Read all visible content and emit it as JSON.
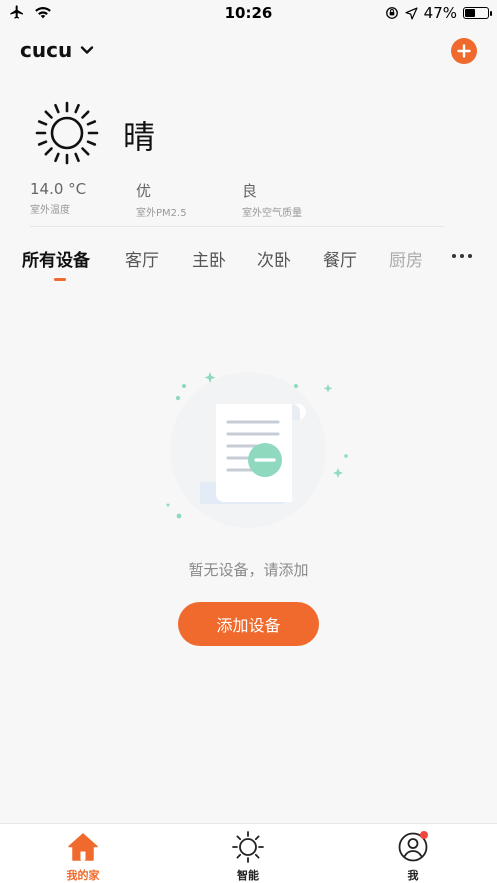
{
  "status_bar": {
    "time": "10:26",
    "battery_text": "47%",
    "battery_level": 0.47
  },
  "header": {
    "home_name": "cucu"
  },
  "weather": {
    "condition": "晴",
    "icon": "sun-icon",
    "metrics": [
      {
        "value": "14.0 °C",
        "label": "室外温度"
      },
      {
        "value": "优",
        "label": "室外PM2.5"
      },
      {
        "value": "良",
        "label": "室外空气质量"
      }
    ]
  },
  "rooms": {
    "tabs": [
      "所有设备",
      "客厅",
      "主卧",
      "次卧",
      "餐厅",
      "厨房"
    ],
    "active_index": 0
  },
  "empty_state": {
    "message": "暂无设备，请添加",
    "button_label": "添加设备"
  },
  "tabbar": {
    "items": [
      {
        "label": "我的家",
        "icon": "home-icon"
      },
      {
        "label": "智能",
        "icon": "smart-sun-icon"
      },
      {
        "label": "我",
        "icon": "profile-icon"
      }
    ],
    "active_index": 0
  },
  "colors": {
    "accent": "#ef6a2c",
    "badge": "#f0463c",
    "illustration_mint": "#8fd9be"
  }
}
